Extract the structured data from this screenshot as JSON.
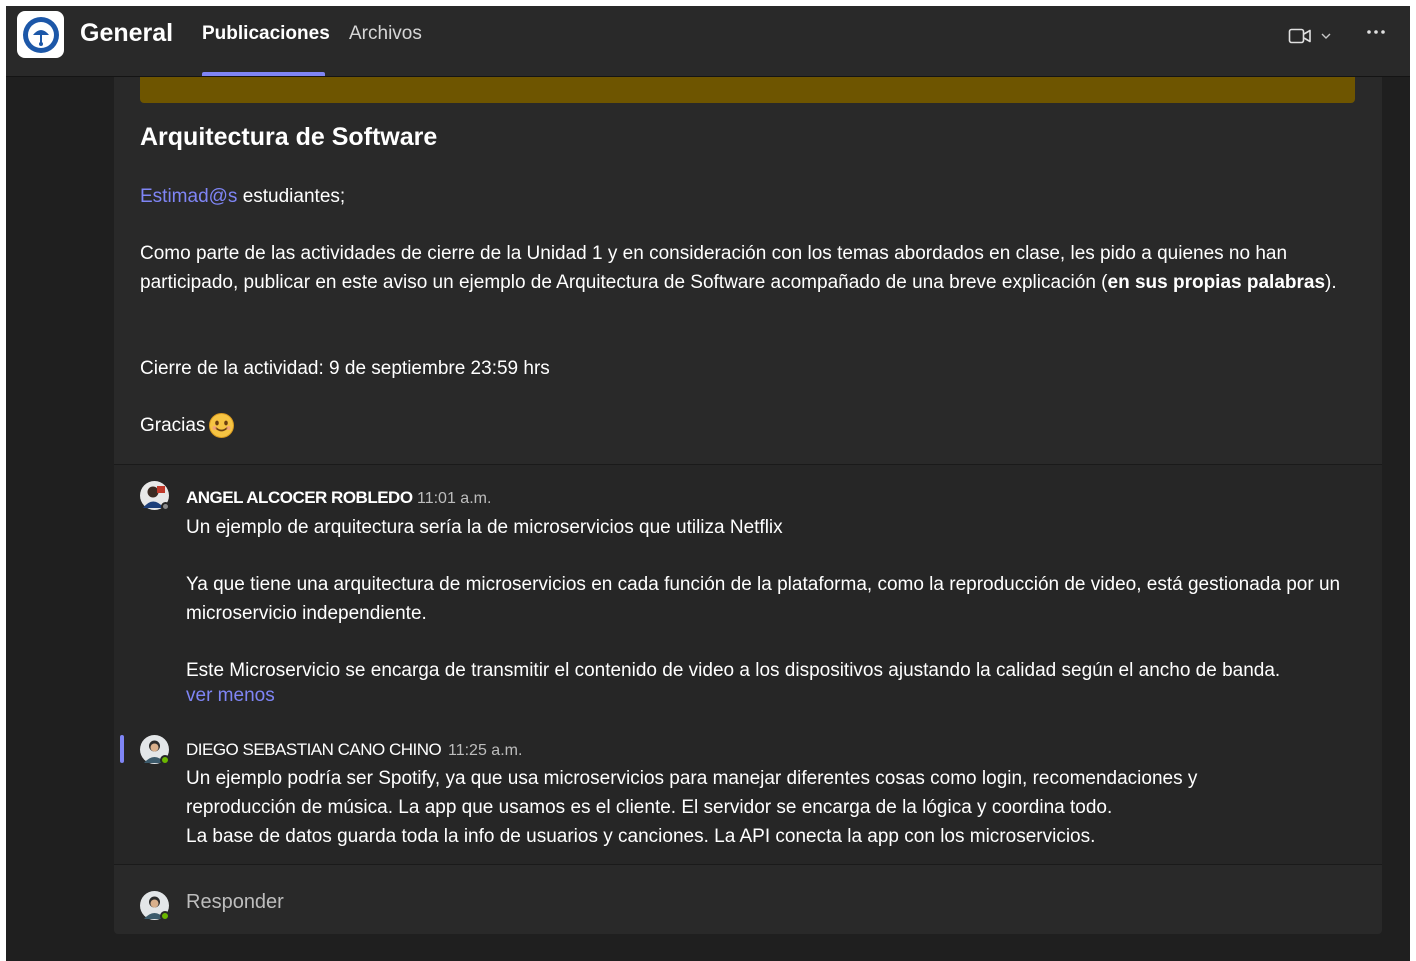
{
  "header": {
    "channel_title": "General",
    "tabs": [
      {
        "label": "Publicaciones",
        "active": true
      },
      {
        "label": "Archivos",
        "active": false
      }
    ],
    "video_icon": "video-camera-icon",
    "more_icon": "ellipsis-icon"
  },
  "post": {
    "accent_color": "#6e5500",
    "title": "Arquitectura de Software",
    "greeting_mention": "Estimad@s",
    "greeting_rest": " estudiantes;",
    "body_1": "Como parte de las actividades de cierre de la Unidad 1 y en consideración con los temas abordados en clase, les pido a quienes no han participado, publicar en este aviso un ejemplo de Arquitectura de Software acompañado de una breve explicación (",
    "body_1_bold": "en sus propias palabras",
    "body_1_end": ").",
    "deadline": "Cierre de la actividad: 9 de septiembre 23:59 hrs",
    "thanks": "Gracias"
  },
  "replies": [
    {
      "author": "ANGEL ALCOCER ROBLEDO",
      "time": "11:01 a.m.",
      "paragraphs": [
        "Un ejemplo de arquitectura sería la de microservicios que utiliza Netflix",
        "Ya que  tiene una arquitectura de microservicios en cada función de la plataforma, como la reproducción de video, está gestionada por un microservicio independiente.",
        "Este  Microservicio se encarga de transmitir el contenido de video a los dispositivos ajustando la calidad según el ancho de banda."
      ],
      "see_less": "ver menos"
    },
    {
      "author": "DIEGO SEBASTIAN CANO CHINO",
      "time": "11:25 a.m.",
      "lines": [
        "Un ejemplo podría ser Spotify, ya que usa microservicios para manejar diferentes cosas como login, recomendaciones y",
        "reproducción de música. La app que usamos es el cliente. El servidor se encarga de la lógica y coordina todo.",
        "La base de datos guarda toda la info de usuarios y canciones. La API conecta la app con los microservicios."
      ]
    }
  ],
  "reply_box": {
    "label": "Responder"
  },
  "colors": {
    "accent": "#7f85f5",
    "presence_online": "#6bb700"
  }
}
